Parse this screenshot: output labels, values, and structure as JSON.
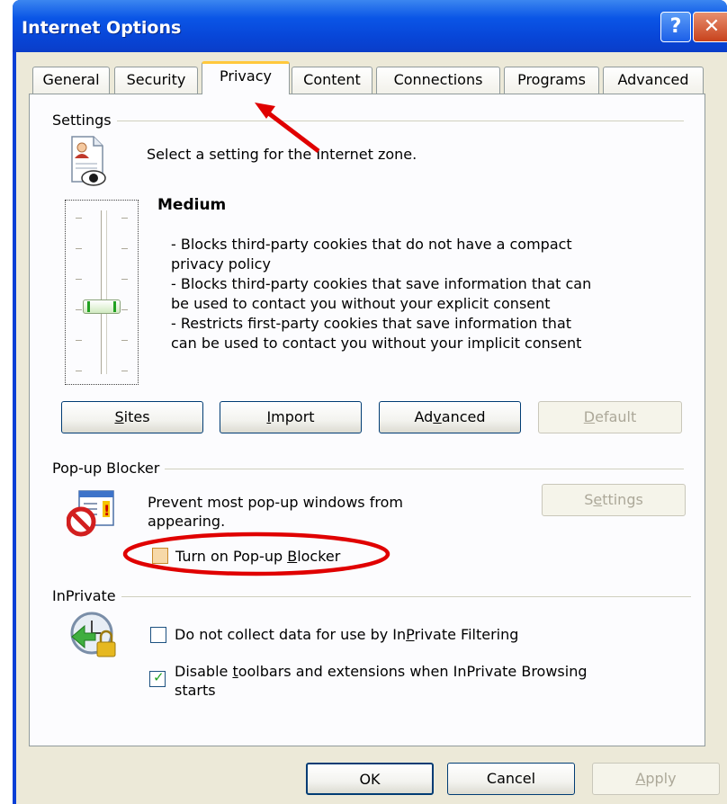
{
  "window": {
    "title": "Internet Options",
    "help_glyph": "?",
    "close_glyph": "✕"
  },
  "tabs": [
    {
      "label": "General"
    },
    {
      "label": "Security"
    },
    {
      "label": "Privacy"
    },
    {
      "label": "Content"
    },
    {
      "label": "Connections"
    },
    {
      "label": "Programs"
    },
    {
      "label": "Advanced"
    }
  ],
  "settings": {
    "heading": "Settings",
    "intro": "Select a setting for the Internet zone.",
    "level": "Medium",
    "slider_level_of_6": 3,
    "desc_lines": [
      "- Blocks third-party cookies that do not have a compact",
      "privacy policy",
      "- Blocks third-party cookies that save information that can",
      "be used to contact you without your explicit consent",
      "- Restricts first-party cookies that save information that",
      "can be used to contact you without your implicit consent"
    ],
    "buttons": {
      "sites": {
        "pre": "",
        "key": "S",
        "post": "ites"
      },
      "import": {
        "pre": "",
        "key": "I",
        "post": "mport"
      },
      "advanced": {
        "pre": "Ad",
        "key": "v",
        "post": "anced"
      },
      "default": {
        "pre": "",
        "key": "D",
        "post": "efault"
      }
    }
  },
  "popup": {
    "heading": "Pop-up Blocker",
    "desc_line1": "Prevent most pop-up windows from",
    "desc_line2": "appearing.",
    "settings_btn": {
      "pre": "S",
      "key": "e",
      "post": "ttings"
    },
    "checkbox": {
      "pre": "Turn on Pop-up ",
      "key": "B",
      "post": "locker",
      "checked": false
    }
  },
  "inprivate": {
    "heading": "InPrivate",
    "opt1": {
      "pre": "Do not collect data for use by In",
      "key": "P",
      "post": "rivate Filtering",
      "checked": false
    },
    "opt2": {
      "pre": "Disable ",
      "key": "t",
      "post": "oolbars and extensions when InPrivate Browsing",
      "line2": "starts",
      "checked": true
    }
  },
  "footer": {
    "ok": "OK",
    "cancel": "Cancel",
    "apply": {
      "pre": "",
      "key": "A",
      "post": "pply"
    }
  },
  "colors": {
    "titlebar": "#0846d8",
    "client_bg": "#ece9d8",
    "annotation_red": "#e00000"
  }
}
